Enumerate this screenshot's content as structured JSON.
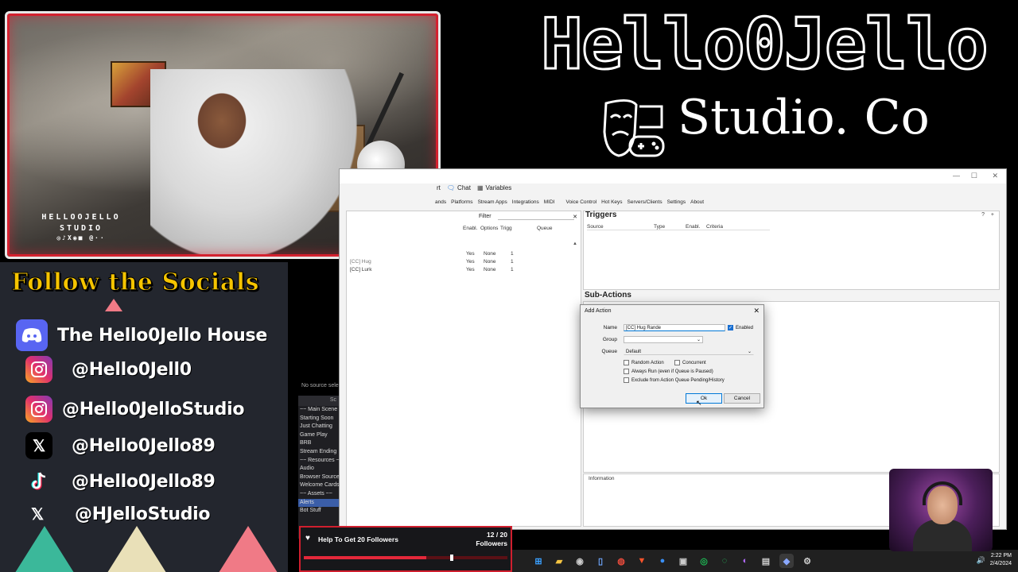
{
  "webcam": {
    "brand_line1": "HELLOOJELLO",
    "brand_line2": "STUDIO",
    "brand_line3": "◎♪X◉■ @··"
  },
  "brand": {
    "title": "Hello0Jello",
    "subtitle": "Studio. Co",
    "logo_icon": "theater-mask-gamepad-icon"
  },
  "socials": {
    "title": "Follow the Socials",
    "items": [
      {
        "icon": "discord-icon",
        "text": "The Hello0Jello House",
        "color": "#5865f2"
      },
      {
        "icon": "instagram-icon",
        "text": "@Hello0Jell0",
        "color": "#e1306c"
      },
      {
        "icon": "instagram-icon",
        "text": "@Hello0JelloStudio",
        "color": "#e1306c"
      },
      {
        "icon": "x-icon",
        "text": "@Hello0Jello89",
        "color": "#000000"
      },
      {
        "icon": "tiktok-icon",
        "text": "@Hello0Jello89",
        "color": "#000000"
      },
      {
        "icon": "x-icon",
        "text": "@HJelloStudio",
        "color": "#000000"
      }
    ]
  },
  "obs": {
    "no_source": "No source sele",
    "scenes_header": "Sc",
    "scenes": [
      "~~ Main Scene",
      "Starting Soon",
      "Just Chatting",
      "Game Play",
      "BRB",
      "Stream Ending",
      "~~ Resources ~",
      "Audio",
      "Browser Source",
      "Welcome Cards",
      "~~ Assets ~~",
      "Alerts",
      "Bot Stuff"
    ]
  },
  "streamerbot": {
    "tabs": [
      "rt",
      "Chat",
      "Variables"
    ],
    "menu": [
      "ands",
      "Platforms",
      "Stream Apps",
      "Integrations",
      "MIDI",
      "Voice Control",
      "Hot Keys",
      "Servers/Clients",
      "Settings",
      "About"
    ],
    "filter_label": "Filter",
    "actions_columns": [
      "Enabl.",
      "Options",
      "Trigg",
      "Queue"
    ],
    "actions_rows": [
      {
        "name": "",
        "enabled": "Yes",
        "options": "None",
        "triggers": "1"
      },
      {
        "name": "[CC] Hug",
        "enabled": "Yes",
        "options": "None",
        "triggers": "1"
      },
      {
        "name": "[CC] Lurk",
        "enabled": "Yes",
        "options": "None",
        "triggers": "1"
      }
    ],
    "triggers_title": "Triggers",
    "triggers_columns": [
      "Source",
      "Type",
      "Enabl.",
      "Criteria"
    ],
    "subactions_title": "Sub-Actions",
    "information_label": "Information"
  },
  "dialog": {
    "title": "Add Action",
    "name_label": "Name",
    "name_value": "[CC] Hug Rande",
    "enabled_label": "Enabled",
    "group_label": "Group",
    "group_value": "",
    "queue_label": "Queue",
    "queue_value": "Default",
    "random_action": "Random Action",
    "concurrent": "Concurrent",
    "always_run": "Always Run (even if Queue is Paused)",
    "exclude": "Exclude from Action Queue Pending/History",
    "ok": "Ok",
    "cancel": "Cancel"
  },
  "goal": {
    "label": "Help To Get 20 Followers",
    "count": "12 / 20",
    "unit": "Followers",
    "progress": 0.6
  },
  "taskbar": {
    "time": "2:22 PM",
    "date": "2/4/2024"
  },
  "colors": {
    "accent_red": "#d01f2e",
    "socials_title": "#f5c400",
    "windows_blue": "#0078d7"
  }
}
